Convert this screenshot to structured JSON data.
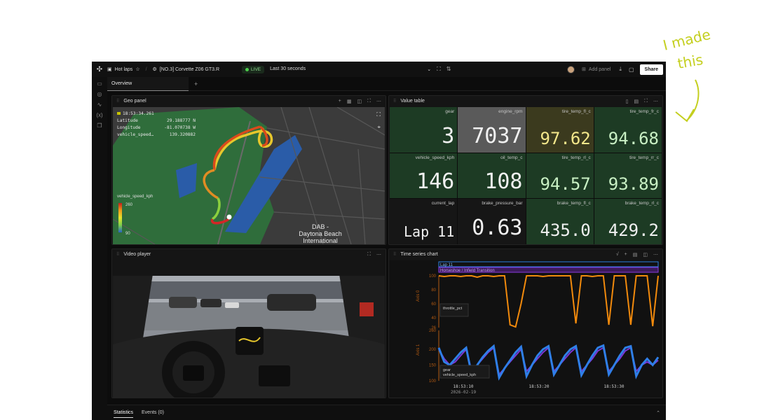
{
  "annotation": {
    "text_line1": "I made",
    "text_line2": "this"
  },
  "topbar": {
    "workspace": "Hot laps",
    "vehicle": "[NO.3] Corvette Z06 GT3.R",
    "live_label": "LIVE",
    "time_range": "Last 30 seconds",
    "add_panel": "Add panel",
    "share": "Share"
  },
  "tabs": {
    "overview": "Overview"
  },
  "geo_panel": {
    "title": "Geo panel",
    "time": "18:53:34.261",
    "rows": [
      {
        "label": "Latitude",
        "value": "29.188777 N"
      },
      {
        "label": "Longitude",
        "value": "-81.070738 W"
      },
      {
        "label": "vehicle_speed…",
        "value": "139.320882"
      }
    ],
    "legend": {
      "title": "vehicle_speed_kph",
      "max": "260",
      "min": "90"
    },
    "map_label_1": "DAB -",
    "map_label_2": "Daytona Beach",
    "map_label_3": "International"
  },
  "value_table": {
    "title": "Value table",
    "cells": [
      {
        "label": "gear",
        "value": "3",
        "bg": "#1d3b24"
      },
      {
        "label": "engine_rpm",
        "value": "7037",
        "bg": "#5a5a5a"
      },
      {
        "label": "tire_temp_fl_c",
        "value": "97.62",
        "bg": "#3b3a1e",
        "fg": "#f3e78b"
      },
      {
        "label": "tire_temp_fr_c",
        "value": "94.68",
        "bg": "#1d3b24",
        "fg": "#c9f0c4"
      },
      {
        "label": "vehicle_speed_kph",
        "value": "146",
        "bg": "#1d3b24"
      },
      {
        "label": "oil_temp_c",
        "value": "108",
        "bg": "#1d3b24"
      },
      {
        "label": "tire_temp_rl_c",
        "value": "94.57",
        "bg": "#1d3b24",
        "fg": "#c9f0c4"
      },
      {
        "label": "tire_temp_rr_c",
        "value": "93.89",
        "bg": "#1d3b24",
        "fg": "#c9f0c4"
      },
      {
        "label": "current_lap",
        "value": "Lap 11",
        "bg": "#161616"
      },
      {
        "label": "brake_pressure_bar",
        "value": "0.63",
        "bg": "#161616"
      },
      {
        "label": "brake_temp_fl_c",
        "value": "435.0",
        "bg": "#1d3b24"
      },
      {
        "label": "brake_temp_rl_c",
        "value": "429.2",
        "bg": "#1d3b24"
      }
    ]
  },
  "video_player": {
    "title": "Video player"
  },
  "time_series": {
    "title": "Time series chart",
    "lap_label": "Lap 11",
    "seg_label": "Horseshoe / Infield Transition",
    "axis0_label": "Axis 0",
    "axis1_label": "Axis 1",
    "legend0": "throttle_pct",
    "legend1a": "gear",
    "legend1b": "vehicle_speed_kph",
    "date": "2026-02-19"
  },
  "chart_data": {
    "type": "line",
    "x_ticks": [
      "18:53:10",
      "18:53:20",
      "18:53:30"
    ],
    "panes": [
      {
        "axis": "Axis 0",
        "ylim": [
          26,
          100
        ],
        "y_ticks": [
          100,
          80,
          60,
          40,
          26
        ],
        "series": [
          {
            "name": "throttle_pct",
            "color": "#f28a0c",
            "x": [
              0,
              1,
              2,
              3,
              4,
              5,
              6,
              7,
              8,
              9,
              10,
              11,
              12,
              13,
              14,
              15,
              16,
              17,
              18,
              19,
              20,
              21,
              22,
              23,
              24,
              25,
              26,
              27,
              28,
              29,
              30,
              31,
              32,
              33,
              34,
              35,
              36,
              37,
              38,
              39,
              40
            ],
            "values": [
              100,
              99,
              100,
              100,
              99,
              100,
              100,
              98,
              100,
              100,
              99,
              100,
              100,
              30,
              27,
              60,
              100,
              100,
              100,
              99,
              100,
              100,
              100,
              100,
              100,
              32,
              100,
              100,
              99,
              100,
              100,
              30,
              100,
              100,
              100,
              30,
              100,
              100,
              100,
              28,
              100
            ]
          }
        ]
      },
      {
        "axis": "Axis 1",
        "ylim": [
          100,
          260
        ],
        "y_ticks": [
          260,
          200,
          150,
          100
        ],
        "series": [
          {
            "name": "vehicle_speed_kph",
            "color": "#2f7fe8",
            "x": [
              0,
              1,
              2,
              3,
              4,
              5,
              6,
              7,
              8,
              9,
              10,
              11,
              12,
              13,
              14,
              15,
              16,
              17,
              18,
              19,
              20,
              21,
              22,
              23,
              24,
              25,
              26,
              27,
              28,
              29,
              30,
              31,
              32,
              33,
              34,
              35,
              36,
              37,
              38,
              39,
              40
            ],
            "values": [
              205,
              160,
              150,
              170,
              190,
              205,
              120,
              150,
              175,
              195,
              210,
              110,
              140,
              165,
              190,
              208,
              115,
              150,
              180,
              200,
              210,
              120,
              150,
              180,
              200,
              210,
              118,
              150,
              180,
              205,
              212,
              120,
              150,
              180,
              205,
              210,
              115,
              150,
              170,
              150,
              175
            ]
          },
          {
            "name": "gear",
            "color": "#7c36d6",
            "x": [
              0,
              1,
              2,
              3,
              4,
              5,
              6,
              7,
              8,
              9,
              10,
              11,
              12,
              13,
              14,
              15,
              16,
              17,
              18,
              19,
              20,
              21,
              22,
              23,
              24,
              25,
              26,
              27,
              28,
              29,
              30,
              31,
              32,
              33,
              34,
              35,
              36,
              37,
              38,
              39,
              40
            ],
            "values": [
              200,
              170,
              150,
              160,
              180,
              200,
              130,
              150,
              170,
              190,
              205,
              120,
              140,
              160,
              180,
              200,
              130,
              150,
              170,
              190,
              205,
              130,
              150,
              170,
              190,
              205,
              130,
              150,
              170,
              195,
              205,
              130,
              150,
              170,
              195,
              205,
              130,
              150,
              160,
              150,
              165
            ]
          }
        ]
      }
    ]
  },
  "bottom": {
    "statistics": "Statistics",
    "events": "Events (0)"
  }
}
